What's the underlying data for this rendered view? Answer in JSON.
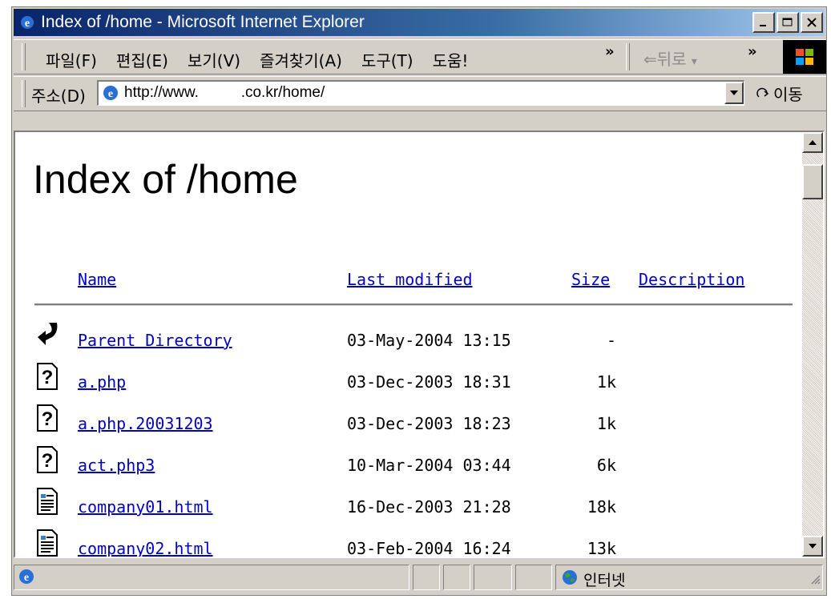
{
  "window": {
    "title": "Index of /home - Microsoft Internet Explorer"
  },
  "menubar": {
    "items": [
      {
        "label": "파일(F)"
      },
      {
        "label": "편집(E)"
      },
      {
        "label": "보기(V)"
      },
      {
        "label": "즐겨찾기(A)"
      },
      {
        "label": "도구(T)"
      },
      {
        "label": "도움!"
      }
    ],
    "chevron": "»",
    "back_label": "⇐뒤로",
    "back_dropdown": "▾",
    "chevron2": "»"
  },
  "address": {
    "label": "주소(D)",
    "url": "http://www.          .co.kr/home/",
    "go_label": "이동"
  },
  "page": {
    "heading": "Index of /home",
    "columns": {
      "name": "Name",
      "last_modified": "Last modified",
      "size": "Size",
      "description": "Description"
    },
    "rows": [
      {
        "icon": "back-arrow-icon",
        "name": "Parent Directory",
        "date": "03-May-2004 13:15",
        "size": "-"
      },
      {
        "icon": "unknown-file-icon",
        "name": "a.php",
        "date": "03-Dec-2003 18:31",
        "size": "1k"
      },
      {
        "icon": "unknown-file-icon",
        "name": "a.php.20031203",
        "date": "03-Dec-2003 18:23",
        "size": "1k"
      },
      {
        "icon": "unknown-file-icon",
        "name": "act.php3",
        "date": "10-Mar-2004 03:44",
        "size": "6k"
      },
      {
        "icon": "html-file-icon",
        "name": "company01.html",
        "date": "16-Dec-2003 21:28",
        "size": "18k"
      },
      {
        "icon": "html-file-icon",
        "name": "company02.html",
        "date": "03-Feb-2004 16:24",
        "size": "13k"
      }
    ]
  },
  "statusbar": {
    "zone": "인터넷"
  },
  "colors": {
    "title_start": "#0a246a",
    "title_end": "#a6caf0",
    "chrome": "#d4d0c8",
    "link": "#0000cc"
  }
}
